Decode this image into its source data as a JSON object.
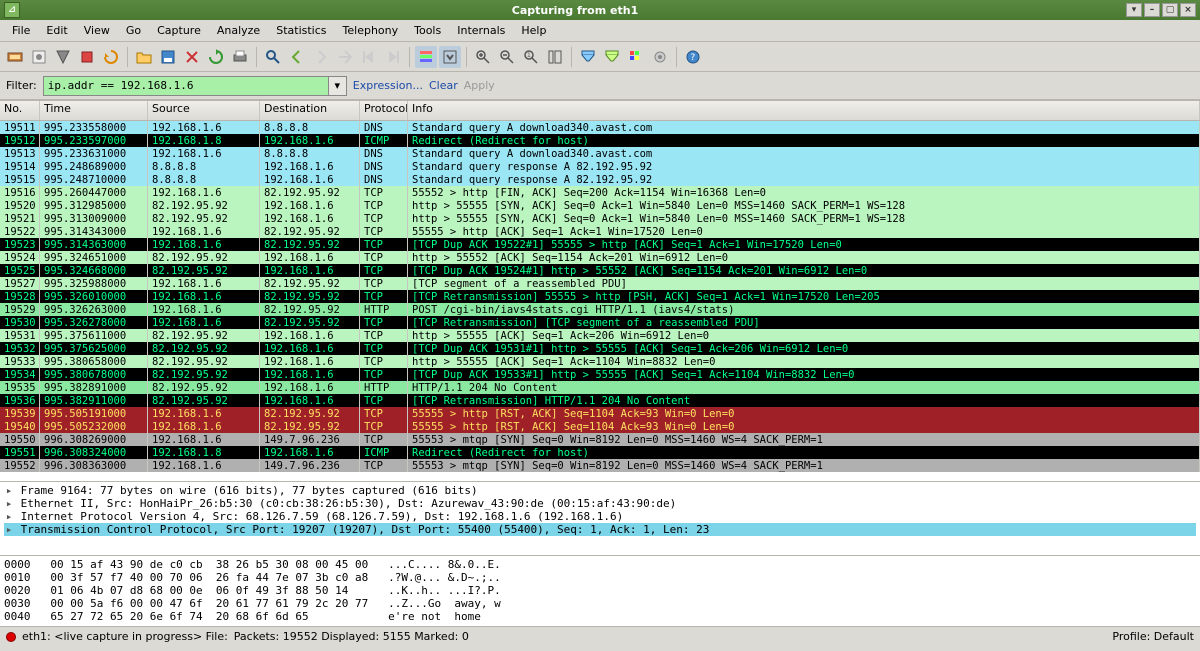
{
  "title": "Capturing from eth1",
  "menu": [
    "File",
    "Edit",
    "View",
    "Go",
    "Capture",
    "Analyze",
    "Statistics",
    "Telephony",
    "Tools",
    "Internals",
    "Help"
  ],
  "filter": {
    "label": "Filter:",
    "value": "ip.addr == 192.168.1.6",
    "expression": "Expression...",
    "clear": "Clear",
    "apply": "Apply"
  },
  "columns": {
    "no": "No.",
    "time": "Time",
    "src": "Source",
    "dst": "Destination",
    "proto": "Protocol",
    "info": "Info"
  },
  "packets": [
    {
      "cls": "row-cyan",
      "no": "19511",
      "time": "995.233558000",
      "src": "192.168.1.6",
      "dst": "8.8.8.8",
      "proto": "DNS",
      "info": "Standard query A download340.avast.com"
    },
    {
      "cls": "row-black",
      "no": "19512",
      "time": "995.233597000",
      "src": "192.168.1.8",
      "dst": "192.168.1.6",
      "proto": "ICMP",
      "info": "Redirect             (Redirect for host)"
    },
    {
      "cls": "row-cyan",
      "no": "19513",
      "time": "995.233631000",
      "src": "192.168.1.6",
      "dst": "8.8.8.8",
      "proto": "DNS",
      "info": "Standard query A download340.avast.com"
    },
    {
      "cls": "row-cyan",
      "no": "19514",
      "time": "995.248689000",
      "src": "8.8.8.8",
      "dst": "192.168.1.6",
      "proto": "DNS",
      "info": "Standard query response A 82.192.95.92"
    },
    {
      "cls": "row-cyan",
      "no": "19515",
      "time": "995.248710000",
      "src": "8.8.8.8",
      "dst": "192.168.1.6",
      "proto": "DNS",
      "info": "Standard query response A 82.192.95.92"
    },
    {
      "cls": "row-ltgreen",
      "no": "19516",
      "time": "995.260447000",
      "src": "192.168.1.6",
      "dst": "82.192.95.92",
      "proto": "TCP",
      "info": "55552 > http [FIN, ACK] Seq=200 Ack=1154 Win=16368 Len=0"
    },
    {
      "cls": "row-ltgreen",
      "no": "19520",
      "time": "995.312985000",
      "src": "82.192.95.92",
      "dst": "192.168.1.6",
      "proto": "TCP",
      "info": "http > 55555 [SYN, ACK] Seq=0 Ack=1 Win=5840 Len=0 MSS=1460 SACK_PERM=1 WS=128"
    },
    {
      "cls": "row-ltgreen",
      "no": "19521",
      "time": "995.313009000",
      "src": "82.192.95.92",
      "dst": "192.168.1.6",
      "proto": "TCP",
      "info": "http > 55555 [SYN, ACK] Seq=0 Ack=1 Win=5840 Len=0 MSS=1460 SACK_PERM=1 WS=128"
    },
    {
      "cls": "row-ltgreen",
      "no": "19522",
      "time": "995.314343000",
      "src": "192.168.1.6",
      "dst": "82.192.95.92",
      "proto": "TCP",
      "info": "55555 > http [ACK] Seq=1 Ack=1 Win=17520 Len=0"
    },
    {
      "cls": "row-black",
      "no": "19523",
      "time": "995.314363000",
      "src": "192.168.1.6",
      "dst": "82.192.95.92",
      "proto": "TCP",
      "info": "[TCP Dup ACK 19522#1] 55555 > http [ACK] Seq=1 Ack=1 Win=17520 Len=0"
    },
    {
      "cls": "row-ltgreen",
      "no": "19524",
      "time": "995.324651000",
      "src": "82.192.95.92",
      "dst": "192.168.1.6",
      "proto": "TCP",
      "info": "http > 55552 [ACK] Seq=1154 Ack=201 Win=6912 Len=0"
    },
    {
      "cls": "row-black",
      "no": "19525",
      "time": "995.324668000",
      "src": "82.192.95.92",
      "dst": "192.168.1.6",
      "proto": "TCP",
      "info": "[TCP Dup ACK 19524#1] http > 55552 [ACK] Seq=1154 Ack=201 Win=6912 Len=0"
    },
    {
      "cls": "row-ltgreen",
      "no": "19527",
      "time": "995.325988000",
      "src": "192.168.1.6",
      "dst": "82.192.95.92",
      "proto": "TCP",
      "info": "[TCP segment of a reassembled PDU]"
    },
    {
      "cls": "row-black",
      "no": "19528",
      "time": "995.326010000",
      "src": "192.168.1.6",
      "dst": "82.192.95.92",
      "proto": "TCP",
      "info": "[TCP Retransmission] 55555 > http [PSH, ACK] Seq=1 Ack=1 Win=17520 Len=205"
    },
    {
      "cls": "row-dgreen",
      "no": "19529",
      "time": "995.326263000",
      "src": "192.168.1.6",
      "dst": "82.192.95.92",
      "proto": "HTTP",
      "info": "POST /cgi-bin/iavs4stats.cgi HTTP/1.1  (iavs4/stats)"
    },
    {
      "cls": "row-black",
      "no": "19530",
      "time": "995.326278000",
      "src": "192.168.1.6",
      "dst": "82.192.95.92",
      "proto": "TCP",
      "info": "[TCP Retransmission] [TCP segment of a reassembled PDU]"
    },
    {
      "cls": "row-ltgreen",
      "no": "19531",
      "time": "995.375611000",
      "src": "82.192.95.92",
      "dst": "192.168.1.6",
      "proto": "TCP",
      "info": "http > 55555 [ACK] Seq=1 Ack=206 Win=6912 Len=0"
    },
    {
      "cls": "row-black",
      "no": "19532",
      "time": "995.375625000",
      "src": "82.192.95.92",
      "dst": "192.168.1.6",
      "proto": "TCP",
      "info": "[TCP Dup ACK 19531#1] http > 55555 [ACK] Seq=1 Ack=206 Win=6912 Len=0"
    },
    {
      "cls": "row-ltgreen",
      "no": "19533",
      "time": "995.380658000",
      "src": "82.192.95.92",
      "dst": "192.168.1.6",
      "proto": "TCP",
      "info": "http > 55555 [ACK] Seq=1 Ack=1104 Win=8832 Len=0"
    },
    {
      "cls": "row-black",
      "no": "19534",
      "time": "995.380678000",
      "src": "82.192.95.92",
      "dst": "192.168.1.6",
      "proto": "TCP",
      "info": "[TCP Dup ACK 19533#1] http > 55555 [ACK] Seq=1 Ack=1104 Win=8832 Len=0"
    },
    {
      "cls": "row-dgreen",
      "no": "19535",
      "time": "995.382891000",
      "src": "82.192.95.92",
      "dst": "192.168.1.6",
      "proto": "HTTP",
      "info": "HTTP/1.1 204 No Content"
    },
    {
      "cls": "row-black",
      "no": "19536",
      "time": "995.382911000",
      "src": "82.192.95.92",
      "dst": "192.168.1.6",
      "proto": "TCP",
      "info": "[TCP Retransmission] HTTP/1.1 204 No Content"
    },
    {
      "cls": "row-dkred",
      "no": "19539",
      "time": "995.505191000",
      "src": "192.168.1.6",
      "dst": "82.192.95.92",
      "proto": "TCP",
      "info": "55555 > http [RST, ACK] Seq=1104 Ack=93 Win=0 Len=0"
    },
    {
      "cls": "row-dkred",
      "no": "19540",
      "time": "995.505232000",
      "src": "192.168.1.6",
      "dst": "82.192.95.92",
      "proto": "TCP",
      "info": "55555 > http [RST, ACK] Seq=1104 Ack=93 Win=0 Len=0"
    },
    {
      "cls": "row-gray",
      "no": "19550",
      "time": "996.308269000",
      "src": "192.168.1.6",
      "dst": "149.7.96.236",
      "proto": "TCP",
      "info": "55553 > mtqp [SYN] Seq=0 Win=8192 Len=0 MSS=1460 WS=4 SACK_PERM=1"
    },
    {
      "cls": "row-black",
      "no": "19551",
      "time": "996.308324000",
      "src": "192.168.1.8",
      "dst": "192.168.1.6",
      "proto": "ICMP",
      "info": "Redirect             (Redirect for host)"
    },
    {
      "cls": "row-gray",
      "no": "19552",
      "time": "996.308363000",
      "src": "192.168.1.6",
      "dst": "149.7.96.236",
      "proto": "TCP",
      "info": "55553 > mtqp [SYN] Seq=0 Win=8192 Len=0 MSS=1460 WS=4 SACK_PERM=1"
    }
  ],
  "tree": [
    "Frame 9164: 77 bytes on wire (616 bits), 77 bytes captured (616 bits)",
    "Ethernet II, Src: HonHaiPr_26:b5:30 (c0:cb:38:26:b5:30), Dst: Azurewav_43:90:de (00:15:af:43:90:de)",
    "Internet Protocol Version 4, Src: 68.126.7.59 (68.126.7.59), Dst: 192.168.1.6 (192.168.1.6)",
    "Transmission Control Protocol, Src Port: 19207 (19207), Dst Port: 55400 (55400), Seq: 1, Ack: 1, Len: 23"
  ],
  "hex": [
    {
      "off": "0000",
      "b": "00 15 af 43 90 de c0 cb  38 26 b5 30 08 00 45 00",
      "a": "...C.... 8&.0..E."
    },
    {
      "off": "0010",
      "b": "00 3f 57 f7 40 00 70 06  26 fa 44 7e 07 3b c0 a8",
      "a": ".?W.@... &.D~.;.."
    },
    {
      "off": "0020",
      "b": "01 06 4b 07 d8 68 00 0e  06 0f 49 3f 88 50 14",
      "a": "..K..h.. ...I?.P."
    },
    {
      "off": "0030",
      "b": "00 00 5a f6 00 00 47 6f  20 61 77 61 79 2c 20 77",
      "a": "..Z...Go  away, w"
    },
    {
      "off": "0040",
      "b": "65 27 72 65 20 6e 6f 74  20 68 6f 6d 65",
      "a": "e're not  home"
    }
  ],
  "status": {
    "left": "eth1: <live capture in progress> File:",
    "mid": "Packets: 19552 Displayed: 5155 Marked: 0",
    "right": "Profile: Default"
  }
}
